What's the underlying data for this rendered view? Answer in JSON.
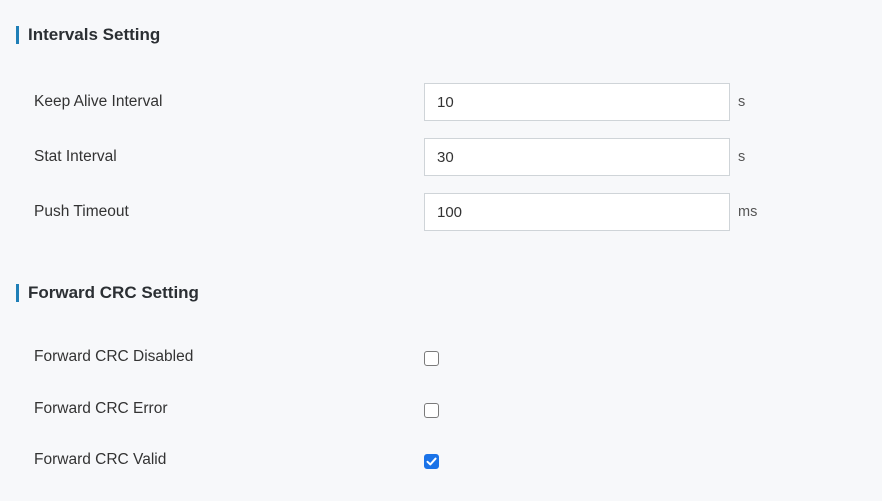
{
  "colors": {
    "accent": "#1f7fb7",
    "checkbox_checked": "#1a73e8",
    "background": "#f7f8fa"
  },
  "intervals": {
    "title": "Intervals Setting",
    "fields": [
      {
        "label": "Keep Alive Interval",
        "value": "10",
        "unit": "s"
      },
      {
        "label": "Stat Interval",
        "value": "30",
        "unit": "s"
      },
      {
        "label": "Push Timeout",
        "value": "100",
        "unit": "ms"
      }
    ]
  },
  "crc": {
    "title": "Forward CRC Setting",
    "options": [
      {
        "label": "Forward CRC Disabled",
        "checked": false
      },
      {
        "label": "Forward CRC Error",
        "checked": false
      },
      {
        "label": "Forward CRC Valid",
        "checked": true,
        "icon": "checkmark-icon"
      }
    ]
  }
}
